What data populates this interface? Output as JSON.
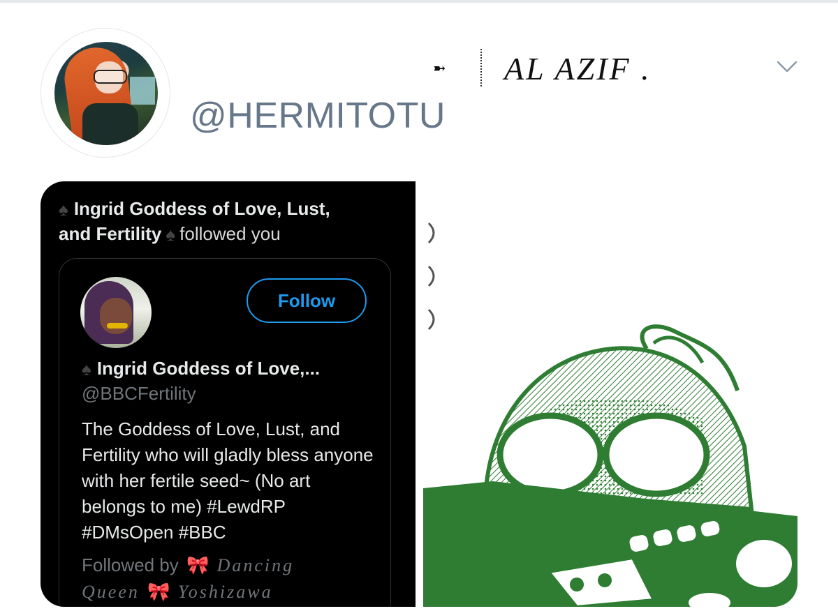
{
  "profile": {
    "handle": "@HERMITOTU",
    "display_name": "AL AZIF .",
    "arrow_icon": "arrow-icon",
    "more_icon": "chevron-down-icon"
  },
  "notification": {
    "name_line1": "Ingrid Goddess of Love, Lust,",
    "name_line2": "and Fertility",
    "action": "followed you",
    "card": {
      "name": "Ingrid Goddess of Love,...",
      "username": "@BBCFertility",
      "follow_label": "Follow",
      "bio": "The Goddess of Love, Lust, and Fertility who will gladly bless anyone with her fertile seed~ (No art belongs to me) #LewdRP #DMsOpen #BBC",
      "followed_by_prefix": "Followed by",
      "follower_1": "Dancing",
      "follower_1b": "Queen",
      "follower_2": "Yoshizawa"
    }
  },
  "colors": {
    "accent": "#1d9bf0",
    "handle": "#66778a",
    "manga_green": "#2e7d32",
    "card_bg": "#000000"
  }
}
